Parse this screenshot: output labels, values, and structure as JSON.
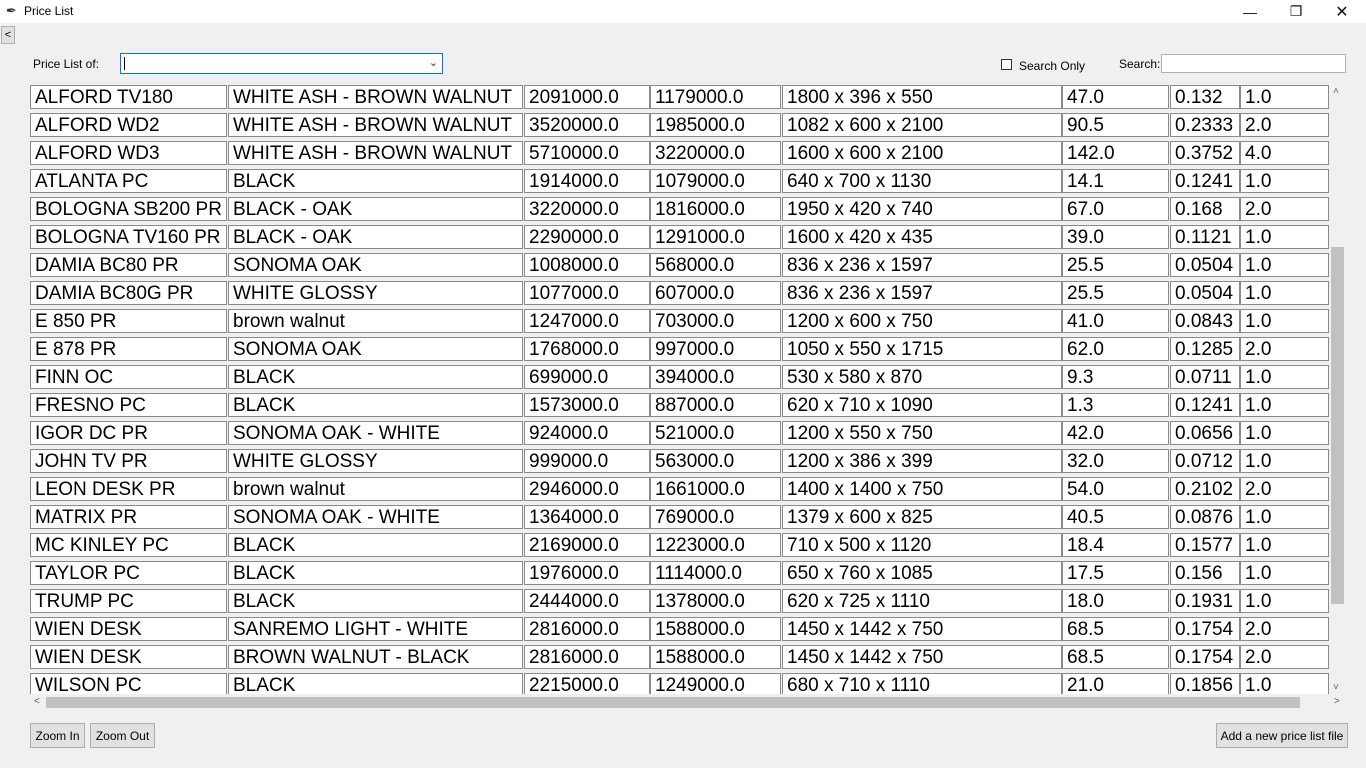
{
  "window": {
    "title": "Price List",
    "icon": "feather-icon"
  },
  "toolbar": {
    "back_label": "<",
    "price_list_label": "Price List of:",
    "price_list_value": "",
    "search_only_label": "Search Only",
    "search_only_checked": false,
    "search_label": "Search:",
    "search_value": ""
  },
  "table": {
    "rows": [
      [
        "ALFORD TV180",
        "WHITE ASH - BROWN WALNUT",
        "2091000.0",
        "1179000.0",
        "1800 x 396 x 550",
        "47.0",
        "0.132",
        "1.0"
      ],
      [
        "ALFORD WD2",
        "WHITE ASH - BROWN WALNUT",
        "3520000.0",
        "1985000.0",
        "1082 x 600 x 2100",
        "90.5",
        "0.2333",
        "2.0"
      ],
      [
        "ALFORD WD3",
        "WHITE ASH - BROWN WALNUT",
        "5710000.0",
        "3220000.0",
        "1600 x 600 x 2100",
        "142.0",
        "0.3752",
        "4.0"
      ],
      [
        "ATLANTA PC",
        "BLACK",
        "1914000.0",
        "1079000.0",
        "640 x 700 x 1130",
        "14.1",
        "0.1241",
        "1.0"
      ],
      [
        "BOLOGNA SB200 PR",
        "BLACK - OAK",
        "3220000.0",
        "1816000.0",
        "1950 x 420 x 740",
        "67.0",
        "0.168",
        "2.0"
      ],
      [
        "BOLOGNA TV160 PR",
        "BLACK - OAK",
        "2290000.0",
        "1291000.0",
        "1600 x 420 x 435",
        "39.0",
        "0.1121",
        "1.0"
      ],
      [
        "DAMIA BC80 PR",
        "SONOMA OAK",
        "1008000.0",
        "568000.0",
        "836 x 236 x 1597",
        "25.5",
        "0.0504",
        "1.0"
      ],
      [
        "DAMIA BC80G PR",
        "WHITE GLOSSY",
        "1077000.0",
        "607000.0",
        "836 x 236 x 1597",
        "25.5",
        "0.0504",
        "1.0"
      ],
      [
        "E 850 PR",
        "brown walnut",
        "1247000.0",
        "703000.0",
        "1200 x 600 x 750",
        "41.0",
        "0.0843",
        "1.0"
      ],
      [
        "E 878 PR",
        "SONOMA OAK",
        "1768000.0",
        "997000.0",
        "1050 x 550 x 1715",
        "62.0",
        "0.1285",
        "2.0"
      ],
      [
        "FINN OC",
        "BLACK",
        "699000.0",
        "394000.0",
        "530 x 580 x 870",
        "9.3",
        "0.0711",
        "1.0"
      ],
      [
        "FRESNO PC",
        "BLACK",
        "1573000.0",
        "887000.0",
        "620 x 710 x 1090",
        "1.3",
        "0.1241",
        "1.0"
      ],
      [
        "IGOR DC PR",
        "SONOMA OAK - WHITE",
        "924000.0",
        "521000.0",
        "1200 x 550 x 750",
        "42.0",
        "0.0656",
        "1.0"
      ],
      [
        "JOHN TV PR",
        "WHITE GLOSSY",
        "999000.0",
        "563000.0",
        "1200 x 386 x 399",
        "32.0",
        "0.0712",
        "1.0"
      ],
      [
        "LEON DESK PR",
        "brown walnut",
        "2946000.0",
        "1661000.0",
        "1400 x 1400 x 750",
        "54.0",
        "0.2102",
        "2.0"
      ],
      [
        "MATRIX PR",
        "SONOMA OAK - WHITE",
        "1364000.0",
        "769000.0",
        "1379 x 600 x 825",
        "40.5",
        "0.0876",
        "1.0"
      ],
      [
        "MC KINLEY PC",
        "BLACK",
        "2169000.0",
        "1223000.0",
        "710 x 500 x 1120",
        "18.4",
        "0.1577",
        "1.0"
      ],
      [
        "TAYLOR PC",
        "BLACK",
        "1976000.0",
        "1114000.0",
        "650 x 760 x 1085",
        "17.5",
        "0.156",
        "1.0"
      ],
      [
        "TRUMP PC",
        "BLACK",
        "2444000.0",
        "1378000.0",
        "620 x 725 x 1110",
        "18.0",
        "0.1931",
        "1.0"
      ],
      [
        "WIEN DESK",
        "SANREMO LIGHT - WHITE",
        "2816000.0",
        "1588000.0",
        "1450 x 1442 x 750",
        "68.5",
        "0.1754",
        "2.0"
      ],
      [
        "WIEN DESK",
        "BROWN WALNUT - BLACK",
        "2816000.0",
        "1588000.0",
        "1450 x 1442 x 750",
        "68.5",
        "0.1754",
        "2.0"
      ],
      [
        "WILSON PC",
        "BLACK",
        "2215000.0",
        "1249000.0",
        "680 x 710 x 1110",
        "21.0",
        "0.1856",
        "1.0"
      ]
    ]
  },
  "footer": {
    "zoom_in_label": "Zoom In",
    "zoom_out_label": "Zoom Out",
    "add_file_label": "Add a new price list file"
  },
  "colors": {
    "accent": "#0078d7",
    "background": "#f0f0f0",
    "cell_border": "#8a8a8a"
  }
}
